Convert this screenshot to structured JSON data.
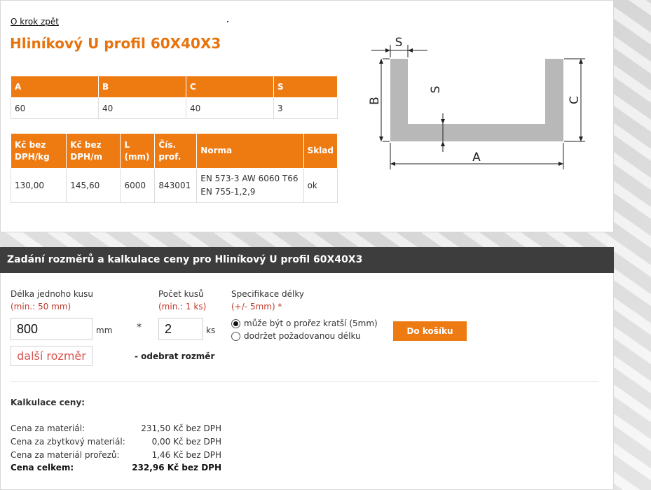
{
  "nav": {
    "back_label": "O krok zpět"
  },
  "product": {
    "title": "Hliníkový U profil 60X40X3"
  },
  "dims_table": {
    "headers": [
      "A",
      "B",
      "C",
      "S"
    ],
    "values": [
      "60",
      "40",
      "40",
      "3"
    ]
  },
  "info_table": {
    "headers": [
      [
        "Kč bez",
        "DPH/kg"
      ],
      [
        "Kč bez",
        "DPH/m"
      ],
      [
        "L",
        "(mm)"
      ],
      [
        "Čís.",
        "prof."
      ],
      [
        "Norma"
      ],
      [
        "Sklad"
      ]
    ],
    "values": {
      "price_kg": "130,00",
      "price_m": "145,60",
      "length": "6000",
      "profile_no": "843001",
      "norm_line1": "EN 573-3 AW 6060 T66",
      "norm_line2": "EN 755-1,2,9",
      "stock": "ok"
    }
  },
  "diagram": {
    "labels": {
      "s_top": "S",
      "s_side": "S",
      "b": "B",
      "c": "C",
      "a": "A"
    }
  },
  "calc": {
    "heading": "Zadání rozměrů a kalkulace ceny pro Hliníkový U profil 60X40X3",
    "length_label": "Délka jednoho kusu",
    "length_min": "(min.: 50 mm)",
    "length_value": "800",
    "length_unit": "mm",
    "multiply": "*",
    "qty_label": "Počet kusů",
    "qty_min": "(min.: 1 ks)",
    "qty_value": "2",
    "qty_unit": "ks",
    "spec_label": "Specifikace délky",
    "spec_tolerance": "(+/- 5mm) *",
    "options": [
      {
        "label": "může být o prořez kratší (5mm)",
        "selected": true
      },
      {
        "label": "dodržet požadovanou délku",
        "selected": false
      }
    ],
    "cart_button": "Do košíku",
    "more_button": "další rozměr",
    "remove_label": "- odebrat rozměr"
  },
  "summary": {
    "title": "Kalkulace ceny:",
    "rows": [
      {
        "label": "Cena za materiál:",
        "value": "231,50 Kč bez DPH"
      },
      {
        "label": "Cena za zbytkový materiál:",
        "value": "0,00 Kč bez DPH"
      },
      {
        "label": "Cena za materiál prořezů:",
        "value": "1,46 Kč bez DPH"
      },
      {
        "label": "Cena celkem:",
        "value": "232,96 Kč bez DPH"
      }
    ]
  }
}
